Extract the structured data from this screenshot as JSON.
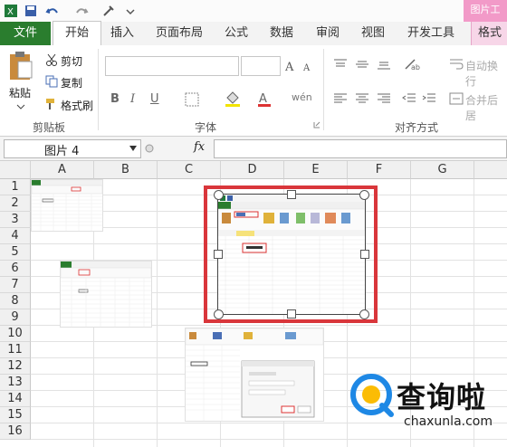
{
  "context_tab": "图片工",
  "tabs": [
    "文件",
    "开始",
    "插入",
    "页面布局",
    "公式",
    "数据",
    "审阅",
    "视图",
    "开发工具",
    "格式"
  ],
  "clipboard": {
    "paste": "粘贴",
    "cut": "剪切",
    "copy": "复制",
    "format_painter": "格式刷",
    "group": "剪贴板"
  },
  "font": {
    "group": "字体",
    "bold": "B",
    "italic": "I",
    "underline": "U",
    "wen": "wén"
  },
  "alignment": {
    "group": "对齐方式",
    "wrap": "自动换行",
    "merge": "合并后居"
  },
  "name_box": "图片 4",
  "fx": "fx",
  "columns": [
    "A",
    "B",
    "C",
    "D",
    "E",
    "F",
    "G"
  ],
  "rows": [
    "1",
    "2",
    "3",
    "4",
    "5",
    "6",
    "7",
    "8",
    "9",
    "10",
    "11",
    "12",
    "13",
    "14",
    "15",
    "16"
  ],
  "watermark": {
    "brand": "查询啦",
    "url": "chaxunla.com"
  },
  "colors": {
    "file_tab": "#2a7d2e",
    "selection_red": "#d9363b",
    "context_tab": "#f29ac8",
    "brand_blue": "#1e88e5"
  }
}
